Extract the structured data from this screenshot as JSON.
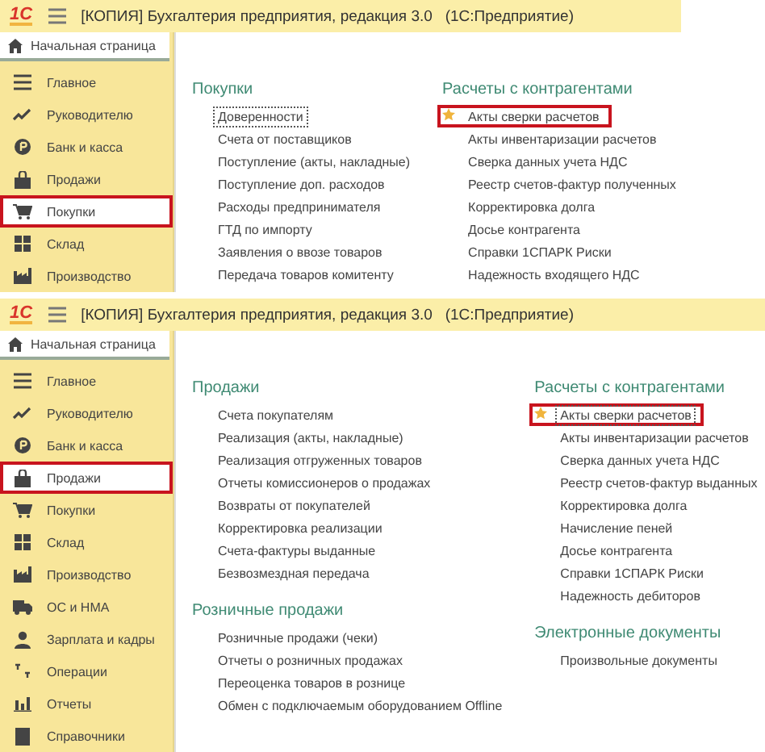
{
  "windows": [
    {
      "logo": "1С",
      "title": "[КОПИЯ] Бухгалтерия предприятия, редакция 3.0   (1С:Предприятие)",
      "home_tab": "Начальная страница",
      "sidebar": [
        {
          "label": "Главное",
          "kind": "menu",
          "selected": false,
          "highlighted": false
        },
        {
          "label": "Руководителю",
          "kind": "trend",
          "selected": false,
          "highlighted": false
        },
        {
          "label": "Банк и касса",
          "kind": "coin",
          "selected": false,
          "highlighted": false
        },
        {
          "label": "Продажи",
          "kind": "bag",
          "selected": false,
          "highlighted": false
        },
        {
          "label": "Покупки",
          "kind": "cart",
          "selected": true,
          "highlighted": true
        },
        {
          "label": "Склад",
          "kind": "grid",
          "selected": false,
          "highlighted": false
        },
        {
          "label": "Производство",
          "kind": "factory",
          "selected": false,
          "highlighted": false
        }
      ],
      "columns": [
        [
          {
            "title": "Покупки",
            "items": [
              {
                "label": "Доверенности",
                "starred": false,
                "focused": true,
                "highlighted": false
              },
              {
                "label": "Счета от поставщиков",
                "starred": false,
                "focused": false,
                "highlighted": false
              },
              {
                "label": "Поступление (акты, накладные)",
                "starred": false,
                "focused": false,
                "highlighted": false
              },
              {
                "label": "Поступление доп. расходов",
                "starred": false,
                "focused": false,
                "highlighted": false
              },
              {
                "label": "Расходы предпринимателя",
                "starred": false,
                "focused": false,
                "highlighted": false
              },
              {
                "label": "ГТД по импорту",
                "starred": false,
                "focused": false,
                "highlighted": false
              },
              {
                "label": "Заявления о ввозе товаров",
                "starred": false,
                "focused": false,
                "highlighted": false
              },
              {
                "label": "Передача товаров комитенту",
                "starred": false,
                "focused": false,
                "highlighted": false
              }
            ]
          }
        ],
        [
          {
            "title": "Расчеты с контрагентами",
            "items": [
              {
                "label": "Акты сверки расчетов",
                "starred": true,
                "focused": false,
                "highlighted": true
              },
              {
                "label": "Акты инвентаризации расчетов",
                "starred": false,
                "focused": false,
                "highlighted": false
              },
              {
                "label": "Сверка данных учета НДС",
                "starred": false,
                "focused": false,
                "highlighted": false
              },
              {
                "label": "Реестр счетов-фактур полученных",
                "starred": false,
                "focused": false,
                "highlighted": false
              },
              {
                "label": "Корректировка долга",
                "starred": false,
                "focused": false,
                "highlighted": false
              },
              {
                "label": "Досье контрагента",
                "starred": false,
                "focused": false,
                "highlighted": false
              },
              {
                "label": "Справки 1СПАРК Риски",
                "starred": false,
                "focused": false,
                "highlighted": false
              },
              {
                "label": "Надежность входящего НДС",
                "starred": false,
                "focused": false,
                "highlighted": false
              }
            ]
          }
        ]
      ]
    },
    {
      "logo": "1С",
      "title": "[КОПИЯ] Бухгалтерия предприятия, редакция 3.0   (1С:Предприятие)",
      "home_tab": "Начальная страница",
      "sidebar": [
        {
          "label": "Главное",
          "kind": "menu",
          "selected": false,
          "highlighted": false
        },
        {
          "label": "Руководителю",
          "kind": "trend",
          "selected": false,
          "highlighted": false
        },
        {
          "label": "Банк и касса",
          "kind": "coin",
          "selected": false,
          "highlighted": false
        },
        {
          "label": "Продажи",
          "kind": "bag",
          "selected": true,
          "highlighted": true
        },
        {
          "label": "Покупки",
          "kind": "cart",
          "selected": false,
          "highlighted": false
        },
        {
          "label": "Склад",
          "kind": "grid",
          "selected": false,
          "highlighted": false
        },
        {
          "label": "Производство",
          "kind": "factory",
          "selected": false,
          "highlighted": false
        },
        {
          "label": "ОС и НМА",
          "kind": "truck",
          "selected": false,
          "highlighted": false
        },
        {
          "label": "Зарплата и кадры",
          "kind": "person",
          "selected": false,
          "highlighted": false
        },
        {
          "label": "Операции",
          "kind": "ops",
          "selected": false,
          "highlighted": false
        },
        {
          "label": "Отчеты",
          "kind": "bars",
          "selected": false,
          "highlighted": false
        },
        {
          "label": "Справочники",
          "kind": "book",
          "selected": false,
          "highlighted": false
        }
      ],
      "columns": [
        [
          {
            "title": "Продажи",
            "items": [
              {
                "label": "Счета покупателям",
                "starred": false,
                "focused": false,
                "highlighted": false
              },
              {
                "label": "Реализация (акты, накладные)",
                "starred": false,
                "focused": false,
                "highlighted": false
              },
              {
                "label": "Реализация отгруженных товаров",
                "starred": false,
                "focused": false,
                "highlighted": false
              },
              {
                "label": "Отчеты комиссионеров о продажах",
                "starred": false,
                "focused": false,
                "highlighted": false
              },
              {
                "label": "Возвраты от покупателей",
                "starred": false,
                "focused": false,
                "highlighted": false
              },
              {
                "label": "Корректировка реализации",
                "starred": false,
                "focused": false,
                "highlighted": false
              },
              {
                "label": "Счета-фактуры выданные",
                "starred": false,
                "focused": false,
                "highlighted": false
              },
              {
                "label": "Безвозмездная передача",
                "starred": false,
                "focused": false,
                "highlighted": false
              }
            ]
          },
          {
            "title": "Розничные продажи",
            "items": [
              {
                "label": "Розничные продажи (чеки)",
                "starred": false,
                "focused": false,
                "highlighted": false
              },
              {
                "label": "Отчеты о розничных продажах",
                "starred": false,
                "focused": false,
                "highlighted": false
              },
              {
                "label": "Переоценка товаров в рознице",
                "starred": false,
                "focused": false,
                "highlighted": false
              },
              {
                "label": "Обмен с подключаемым оборудованием Offline",
                "starred": false,
                "focused": false,
                "highlighted": false
              }
            ]
          }
        ],
        [
          {
            "title": "Расчеты с контрагентами",
            "items": [
              {
                "label": "Акты сверки расчетов",
                "starred": true,
                "focused": true,
                "highlighted": true
              },
              {
                "label": "Акты инвентаризации расчетов",
                "starred": false,
                "focused": false,
                "highlighted": false
              },
              {
                "label": "Сверка данных учета НДС",
                "starred": false,
                "focused": false,
                "highlighted": false
              },
              {
                "label": "Реестр счетов-фактур выданных",
                "starred": false,
                "focused": false,
                "highlighted": false
              },
              {
                "label": "Корректировка долга",
                "starred": false,
                "focused": false,
                "highlighted": false
              },
              {
                "label": "Начисление пеней",
                "starred": false,
                "focused": false,
                "highlighted": false
              },
              {
                "label": "Досье контрагента",
                "starred": false,
                "focused": false,
                "highlighted": false
              },
              {
                "label": "Справки 1СПАРК Риски",
                "starred": false,
                "focused": false,
                "highlighted": false
              },
              {
                "label": "Надежность дебиторов",
                "starred": false,
                "focused": false,
                "highlighted": false
              }
            ]
          },
          {
            "title": "Электронные документы",
            "items": [
              {
                "label": "Произвольные документы",
                "starred": false,
                "focused": false,
                "highlighted": false
              }
            ]
          }
        ]
      ]
    }
  ]
}
